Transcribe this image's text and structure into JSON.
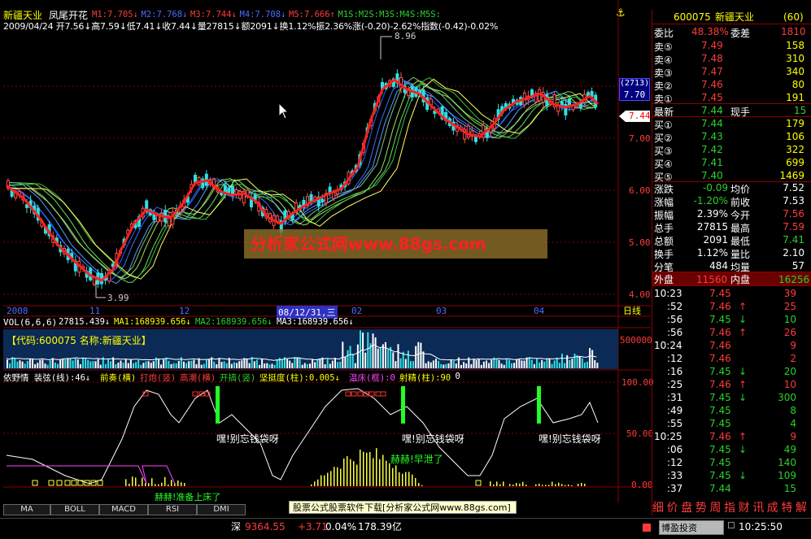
{
  "header": {
    "stock_name": "新疆天业",
    "formula_name": "凤尾开花",
    "ma_items": [
      {
        "label": "M1:7.705↓",
        "color": "#ff3b3b"
      },
      {
        "label": "M2:7.768↓",
        "color": "#4b6bff"
      },
      {
        "label": "M3:7.744↓",
        "color": "#ff3b3b"
      },
      {
        "label": "M4:7.708↓",
        "color": "#4b6bff"
      },
      {
        "label": "M5:7.666↑",
        "color": "#ff3b3b"
      },
      {
        "label": "M1S:M2S:M3S:M4S:M5S:",
        "color": "#2bd12b"
      }
    ],
    "day_info": "2009/04/24 开7.56↓高7.59↓低7.41↓收7.44↓量27815↓额2091↓换1.12%振2.36%涨(-0.20)-2.62%指数(-0.42)-0.02%"
  },
  "main_chart": {
    "price_axis": [
      "7.00",
      "6.00",
      "5.00",
      "4.00"
    ],
    "current_price_tag": "7.44",
    "cursor_price_count": "(2713)",
    "cursor_price": "7.70",
    "high_label": "8.96",
    "low_label": "3.99",
    "watermark": "分析家公式网www.88gs.com",
    "date_labels": [
      "2008",
      "11",
      "12",
      "08/12/31,三",
      "02",
      "03",
      "04"
    ],
    "period_label": "日线"
  },
  "volume_panel": {
    "title": "VOL(6,6,6)",
    "items": [
      {
        "label": "27815.439↓",
        "color": "#ffffff"
      },
      {
        "label": "MA1:168939.656↓",
        "color": "#ffff00"
      },
      {
        "label": "MA2:168939.656↓",
        "color": "#2bd12b"
      },
      {
        "label": "MA3:168939.656↓",
        "color": "#ffffff"
      }
    ],
    "code_label": "【代码:600075 名称:新疆天业】",
    "axis_label": "500000"
  },
  "indicator_panel": {
    "items": [
      {
        "label": "依野情 装弦(线):46↓",
        "color": "#ffffff"
      },
      {
        "label": "前奏(横)",
        "color": "#ffff00"
      },
      {
        "label": "打炮(竖)",
        "color": "#ff3b3b"
      },
      {
        "label": "高潮(横)",
        "color": "#ff3b3b"
      },
      {
        "label": "开搞(竖)",
        "color": "#2bd12b"
      },
      {
        "label": "坚挺度(柱):0.005↓",
        "color": "#ffff00"
      },
      {
        "label": "温床(框):0",
        "color": "#ff44ff"
      },
      {
        "label": "射精(柱):90",
        "color": "#ffff00"
      },
      {
        "label": "0",
        "color": "#ffffff"
      }
    ],
    "axis_labels": [
      "100.00",
      "50.00",
      "0.00"
    ],
    "annotations": [
      "嘿!别忘钱袋呀",
      "嘿!别忘钱袋呀",
      "嘿!别忘钱袋呀",
      "赫赫!早泄了",
      "赫赫!准备上床了"
    ]
  },
  "bottom_tabs": [
    "MA",
    "BOLL",
    "MACD",
    "RSI",
    "DMI"
  ],
  "ad_text": "股票公式股票软件下载[分析家公式网www.88gs.com]",
  "status_bar": {
    "market_label": "深",
    "index_value": "9364.55",
    "index_change": "+3.71",
    "index_pct": "0.04%",
    "turnover": "178.39亿",
    "broker": "博盈投资",
    "time": "10:25:50"
  },
  "quote_panel": {
    "code": "600075",
    "name": "新疆天业",
    "count": "(60)",
    "weibi_label": "委比",
    "weibi_value": "48.38%",
    "weicha_label": "委差",
    "weicha_value": "1810",
    "asks": [
      {
        "label": "卖⑤",
        "price": "7.49",
        "vol": "158"
      },
      {
        "label": "卖④",
        "price": "7.48",
        "vol": "310"
      },
      {
        "label": "卖③",
        "price": "7.47",
        "vol": "340"
      },
      {
        "label": "卖②",
        "price": "7.46",
        "vol": "80"
      },
      {
        "label": "卖①",
        "price": "7.45",
        "vol": "191"
      }
    ],
    "latest": {
      "label": "最新",
      "price": "7.44",
      "label2": "现手",
      "value2": "15"
    },
    "bids": [
      {
        "label": "买①",
        "price": "7.44",
        "vol": "179"
      },
      {
        "label": "买②",
        "price": "7.43",
        "vol": "106"
      },
      {
        "label": "买③",
        "price": "7.42",
        "vol": "322"
      },
      {
        "label": "买④",
        "price": "7.41",
        "vol": "699"
      },
      {
        "label": "买⑤",
        "price": "7.40",
        "vol": "1469"
      }
    ],
    "stats": [
      {
        "l1": "涨跌",
        "v1": "-0.09",
        "l2": "均价",
        "v2": "7.52",
        "c1": "#2bd12b",
        "c2": "#ffffff"
      },
      {
        "l1": "涨幅",
        "v1": "-1.20%",
        "l2": "前收",
        "v2": "7.53",
        "c1": "#2bd12b",
        "c2": "#ffffff"
      },
      {
        "l1": "振幅",
        "v1": "2.39%",
        "l2": "今开",
        "v2": "7.56",
        "c1": "#ffffff",
        "c2": "#ff3b3b"
      },
      {
        "l1": "总手",
        "v1": "27815",
        "l2": "最高",
        "v2": "7.59",
        "c1": "#ffffff",
        "c2": "#ff3b3b"
      },
      {
        "l1": "总额",
        "v1": "2091",
        "l2": "最低",
        "v2": "7.41",
        "c1": "#ffffff",
        "c2": "#2bd12b"
      },
      {
        "l1": "换手",
        "v1": "1.12%",
        "l2": "量比",
        "v2": "2.10",
        "c1": "#ffffff",
        "c2": "#ffffff"
      },
      {
        "l1": "分笔",
        "v1": "484",
        "l2": "均量",
        "v2": "57",
        "c1": "#ffffff",
        "c2": "#ffffff"
      }
    ],
    "outer_label": "外盘",
    "outer_value": "11560",
    "inner_label": "内盘",
    "inner_value": "16256",
    "ticks": [
      {
        "time": "10:23",
        "price": "7.45",
        "arrow": "",
        "vol": "39",
        "color": "#ff3b3b"
      },
      {
        "time": ":52",
        "price": "7.46",
        "arrow": "↑",
        "vol": "25",
        "color": "#ff3b3b"
      },
      {
        "time": ":56",
        "price": "7.45",
        "arrow": "↓",
        "vol": "10",
        "color": "#2bd12b"
      },
      {
        "time": ":56",
        "price": "7.46",
        "arrow": "↑",
        "vol": "26",
        "color": "#ff3b3b"
      },
      {
        "time": "10:24",
        "price": "7.46",
        "arrow": "",
        "vol": "9",
        "color": "#ff3b3b"
      },
      {
        "time": ":12",
        "price": "7.46",
        "arrow": "",
        "vol": "2",
        "color": "#ff3b3b"
      },
      {
        "time": ":16",
        "price": "7.45",
        "arrow": "↓",
        "vol": "20",
        "color": "#2bd12b"
      },
      {
        "time": ":25",
        "price": "7.46",
        "arrow": "↑",
        "vol": "10",
        "color": "#ff3b3b"
      },
      {
        "time": ":31",
        "price": "7.45",
        "arrow": "↓",
        "vol": "300",
        "color": "#2bd12b"
      },
      {
        "time": ":49",
        "price": "7.45",
        "arrow": "",
        "vol": "8",
        "color": "#2bd12b"
      },
      {
        "time": ":55",
        "price": "7.45",
        "arrow": "",
        "vol": "4",
        "color": "#2bd12b"
      },
      {
        "time": "10:25",
        "price": "7.46",
        "arrow": "↑",
        "vol": "9",
        "color": "#ff3b3b"
      },
      {
        "time": ":06",
        "price": "7.45",
        "arrow": "↓",
        "vol": "49",
        "color": "#2bd12b"
      },
      {
        "time": ":12",
        "price": "7.45",
        "arrow": "",
        "vol": "140",
        "color": "#2bd12b"
      },
      {
        "time": ":33",
        "price": "7.45",
        "arrow": "↓",
        "vol": "109",
        "color": "#2bd12b"
      },
      {
        "time": ":37",
        "price": "7.44",
        "arrow": "",
        "vol": "15",
        "color": "#2bd12b"
      }
    ],
    "bottom_menu": [
      "细",
      "价",
      "盘",
      "势",
      "周",
      "指",
      "财",
      "讯",
      "成",
      "特",
      "解"
    ]
  }
}
